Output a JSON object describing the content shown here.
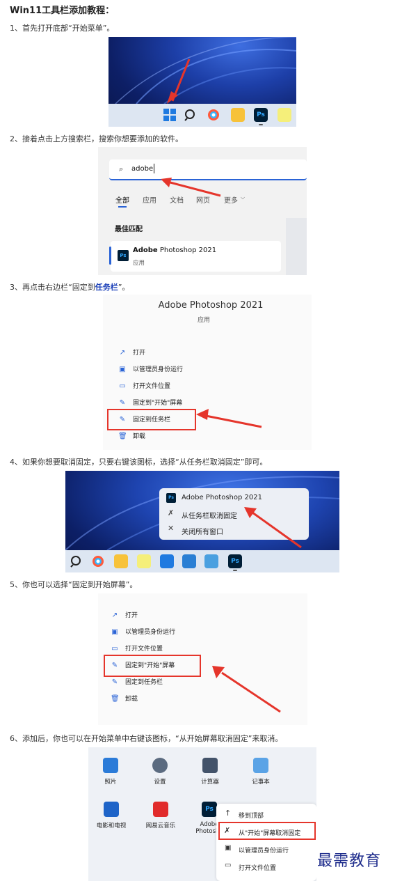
{
  "title": "Win11工具栏添加教程：",
  "steps": {
    "s1": "1、首先打开底部“开始菜单”。",
    "s2": "2、接着点击上方搜索栏，搜索你想要添加的软件。",
    "s3_pre": "3、再点击右边栏“固定到",
    "s3_link": "任务栏",
    "s3_post": "”。",
    "s4": "4、如果你想要取消固定，只要右键该图标，选择“从任务栏取消固定”即可。",
    "s5": "5、你也可以选择“固定到开始屏幕”。",
    "s6": "6、添加后，你也可以在开始菜单中右键该图标，“从开始屏幕取消固定”来取消。"
  },
  "shot2": {
    "search_value": "adobe",
    "tabs": [
      "全部",
      "应用",
      "文档",
      "网页",
      "更多"
    ],
    "best_match": "最佳匹配",
    "result_name_bold": "Adobe",
    "result_name_rest": " Photoshop 2021",
    "result_type": "应用"
  },
  "shot3": {
    "app_title": "Adobe Photoshop 2021",
    "app_type": "应用",
    "menu": [
      "打开",
      "以管理员身份运行",
      "打开文件位置",
      "固定到\"开始\"屏幕",
      "固定到任务栏",
      "卸载"
    ]
  },
  "shot4": {
    "popup": [
      "Adobe Photoshop 2021",
      "从任务栏取消固定",
      "关闭所有窗口"
    ]
  },
  "shot5": {
    "menu": [
      "打开",
      "以管理员身份运行",
      "打开文件位置",
      "固定到\"开始\"屏幕",
      "固定到任务栏",
      "卸载"
    ]
  },
  "shot6": {
    "apps_row1": [
      "照片",
      "设置",
      "计算器",
      "记事本"
    ],
    "apps_row2": [
      "电影和电视",
      "网易云音乐",
      "Adobe",
      "Photosho"
    ],
    "ctx": [
      "移到顶部",
      "从\"开始\"屏幕取消固定",
      "以管理员身份运行",
      "打开文件位置"
    ]
  },
  "ps_label": "Ps",
  "watermark": "最需教育",
  "colors": {
    "accent": "#2a63d6",
    "highlight_box": "#e5352b",
    "link": "#1a3fb8"
  }
}
